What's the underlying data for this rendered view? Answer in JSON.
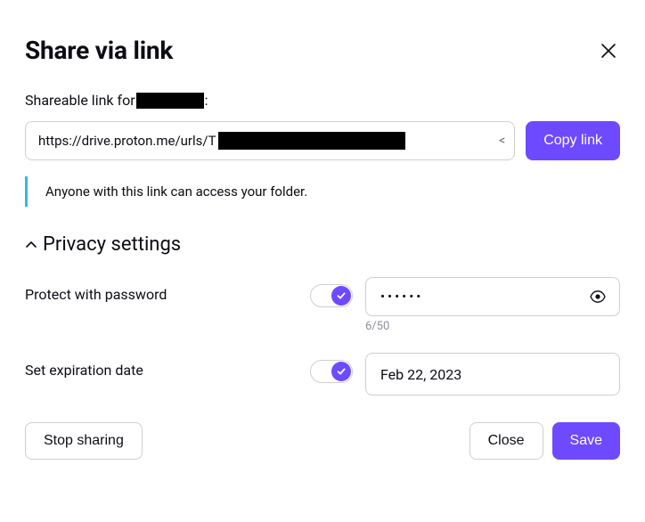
{
  "header": {
    "title": "Share via link"
  },
  "subtitle": {
    "prefix": "Shareable link for",
    "suffix": ":"
  },
  "link": {
    "url_visible": "https://drive.proton.me/urls/T",
    "trailing": "<",
    "copy_label": "Copy link"
  },
  "info": {
    "message": "Anyone with this link can access your folder."
  },
  "privacy": {
    "section_title": "Privacy settings",
    "password": {
      "label": "Protect with password",
      "enabled": true,
      "value_masked": "••••••",
      "counter": "6/50"
    },
    "expiration": {
      "label": "Set expiration date",
      "enabled": true,
      "date": "Feb 22, 2023"
    }
  },
  "footer": {
    "stop_label": "Stop sharing",
    "close_label": "Close",
    "save_label": "Save"
  },
  "colors": {
    "accent": "#6d4aff",
    "info_border": "#35b6ed"
  }
}
